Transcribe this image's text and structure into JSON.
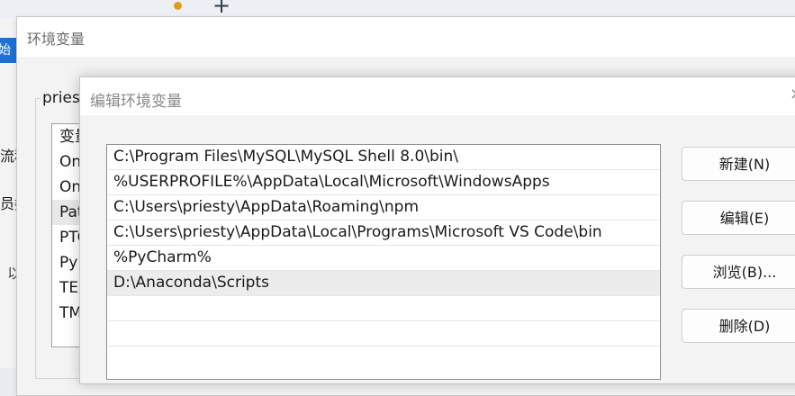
{
  "background": {
    "left_fragments": [
      "始",
      "流程",
      "员委",
      "以"
    ]
  },
  "env_window": {
    "title": "环境变量",
    "group_label": "pries",
    "list_rows": [
      "变量",
      "On",
      "On",
      "Pat",
      "PTC",
      "Py",
      "TEI",
      "TM"
    ]
  },
  "edit_dialog": {
    "title": "编辑环境变量",
    "close_glyph": "×",
    "paths": [
      "C:\\Program Files\\MySQL\\MySQL Shell 8.0\\bin\\",
      "%USERPROFILE%\\AppData\\Local\\Microsoft\\WindowsApps",
      "C:\\Users\\priesty\\AppData\\Roaming\\npm",
      "C:\\Users\\priesty\\AppData\\Local\\Programs\\Microsoft VS Code\\bin",
      "%PyCharm%",
      "D:\\Anaconda\\Scripts",
      "",
      ""
    ],
    "buttons": {
      "new": "新建(N)",
      "edit": "编辑(E)",
      "browse": "浏览(B)...",
      "delete": "删除(D)"
    }
  }
}
